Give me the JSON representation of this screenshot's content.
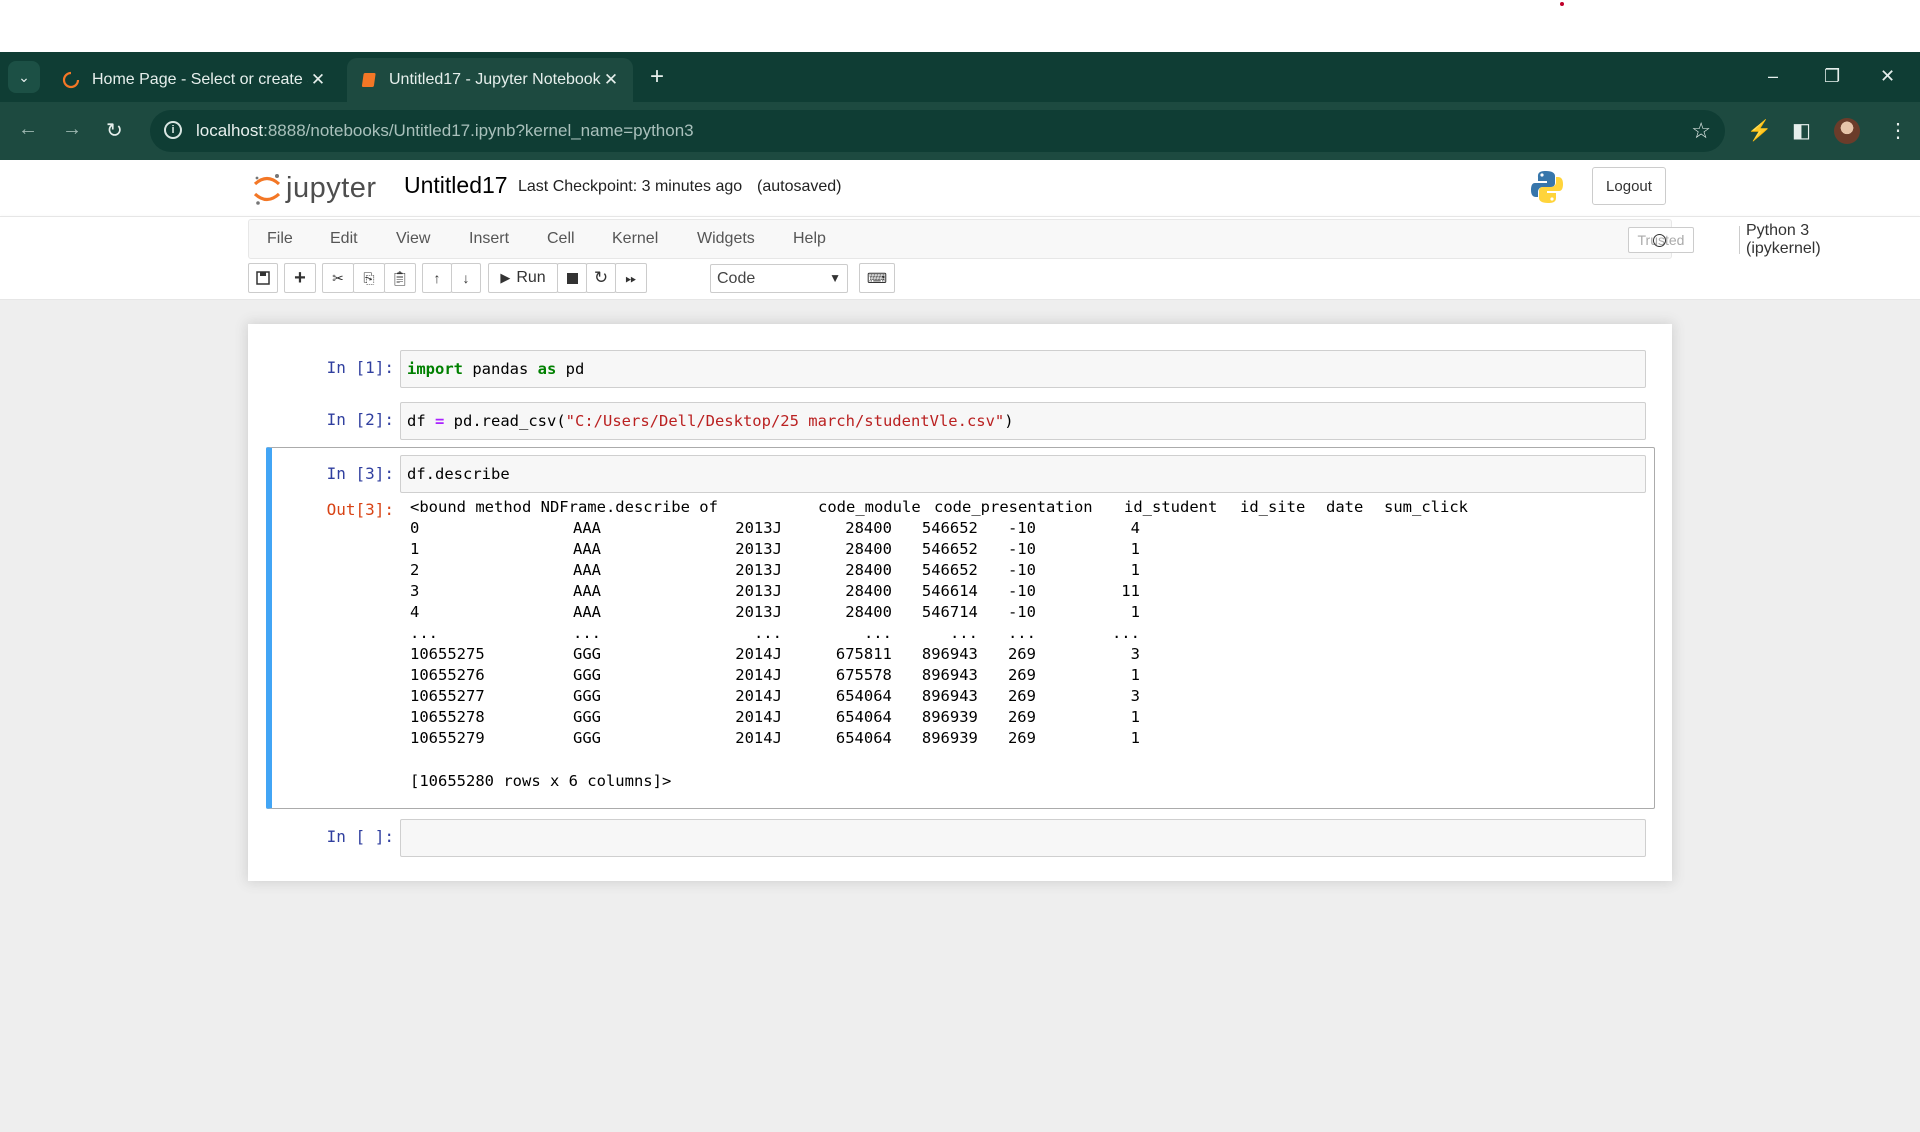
{
  "browser": {
    "tabs": [
      {
        "title": "Home Page - Select or create a",
        "active": false
      },
      {
        "title": "Untitled17 - Jupyter Notebook",
        "active": true
      }
    ],
    "url": {
      "host": "localhost",
      "rest": ":8888/notebooks/Untitled17.ipynb?kernel_name=python3"
    },
    "accent": "#0f3d34"
  },
  "jupyter": {
    "logo_text": "jupyter",
    "notebook_name": "Untitled17",
    "checkpoint": "Last Checkpoint: 3 minutes ago",
    "autosave": "(autosaved)",
    "logout": "Logout",
    "menu": [
      "File",
      "Edit",
      "View",
      "Insert",
      "Cell",
      "Kernel",
      "Widgets",
      "Help"
    ],
    "trusted": "Trusted",
    "kernel": "Python 3 (ipykernel)",
    "run_label": "Run",
    "cell_type": "Code"
  },
  "cells": [
    {
      "prompt": "In [1]:",
      "code": "import pandas as pd"
    },
    {
      "prompt": "In [2]:",
      "code": "df = pd.read_csv(\"C:/Users/Dell/Desktop/25 march/studentVle.csv\")"
    },
    {
      "prompt": "In [3]:",
      "code": "df.describe",
      "out_prompt": "Out[3]:"
    },
    {
      "prompt": "In [ ]:",
      "code": ""
    }
  ],
  "output": {
    "header": [
      "<bound method NDFrame.describe of",
      "code_module",
      "code_presentation",
      "id_student",
      "id_site",
      "date",
      "sum_click"
    ],
    "rows": [
      [
        "0",
        "AAA",
        "2013J",
        "28400",
        "546652",
        "-10",
        "4"
      ],
      [
        "1",
        "AAA",
        "2013J",
        "28400",
        "546652",
        "-10",
        "1"
      ],
      [
        "2",
        "AAA",
        "2013J",
        "28400",
        "546652",
        "-10",
        "1"
      ],
      [
        "3",
        "AAA",
        "2013J",
        "28400",
        "546614",
        "-10",
        "11"
      ],
      [
        "4",
        "AAA",
        "2013J",
        "28400",
        "546714",
        "-10",
        "1"
      ],
      [
        "...",
        "...",
        "...",
        "...",
        "...",
        "...",
        "..."
      ],
      [
        "10655275",
        "GGG",
        "2014J",
        "675811",
        "896943",
        "269",
        "3"
      ],
      [
        "10655276",
        "GGG",
        "2014J",
        "675578",
        "896943",
        "269",
        "1"
      ],
      [
        "10655277",
        "GGG",
        "2014J",
        "654064",
        "896943",
        "269",
        "3"
      ],
      [
        "10655278",
        "GGG",
        "2014J",
        "654064",
        "896939",
        "269",
        "1"
      ],
      [
        "10655279",
        "GGG",
        "2014J",
        "654064",
        "896939",
        "269",
        "1"
      ]
    ],
    "footer": "[10655280 rows x 6 columns]>"
  }
}
